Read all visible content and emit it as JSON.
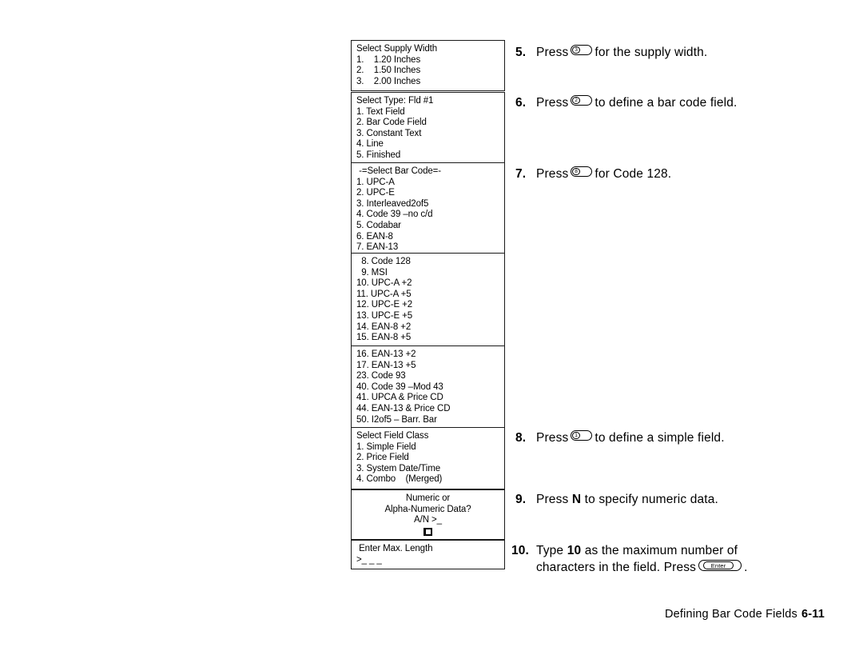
{
  "page": {
    "footer_text": "Defining Bar Code Fields",
    "footer_page": "6-11"
  },
  "screens": [
    {
      "name": "select-supply-width",
      "lines": [
        "Select Supply Width",
        "1.    1.20 Inches",
        "2.    1.50 Inches",
        "3.    2.00 Inches"
      ]
    },
    {
      "name": "select-type-fld1",
      "lines": [
        "Select Type: Fld #1",
        "1. Text Field",
        "2. Bar Code Field",
        "3. Constant Text",
        "4. Line",
        "5. Finished"
      ]
    },
    {
      "name": "select-bar-code-page1",
      "lines": [
        " -=Select Bar Code=-",
        "1. UPC-A",
        "2. UPC-E",
        "3. Interleaved2of5",
        "4. Code 39 –no c/d",
        "5. Codabar",
        "6. EAN-8",
        "7. EAN-13"
      ]
    },
    {
      "name": "select-bar-code-page2",
      "lines": [
        "  8. Code 128",
        "  9. MSI",
        "10. UPC-A +2",
        "11. UPC-A +5",
        "12. UPC-E +2",
        "13. UPC-E +5",
        "14. EAN-8 +2",
        "15. EAN-8 +5"
      ]
    },
    {
      "name": "select-bar-code-page3",
      "lines": [
        "16. EAN-13 +2",
        "17. EAN-13 +5",
        "23. Code 93",
        "40. Code 39 –Mod 43",
        "41. UPCA & Price CD",
        "44. EAN-13 & Price CD",
        "50. I2of5 – Barr. Bar"
      ]
    },
    {
      "name": "select-field-class",
      "lines": [
        "Select Field Class",
        "1. Simple Field",
        "2. Price Field",
        "3. System Date/Time",
        "4. Combo    (Merged)"
      ]
    },
    {
      "name": "numeric-or-alpha-numeric-prompt",
      "lines": [
        "Numeric or",
        "Alpha-Numeric Data?",
        "A/N >_"
      ]
    },
    {
      "name": "enter-max-length",
      "lines": [
        " Enter Max. Length",
        ">_ _ _"
      ]
    }
  ],
  "steps": [
    {
      "number": "5.",
      "pre": "Press",
      "key": "3",
      "post": "for the supply width."
    },
    {
      "number": "6.",
      "pre": "Press",
      "key": "2",
      "post": "to define a bar code field."
    },
    {
      "number": "7.",
      "pre": "Press",
      "key": "8",
      "post": "for Code 128."
    },
    {
      "number": "8.",
      "pre": "Press",
      "key": "1",
      "post": "to define a simple field."
    },
    {
      "number": "9.",
      "pre": "Press",
      "emphasis": "N",
      "post": "to specify numeric data."
    },
    {
      "number": "10.",
      "pre": "Type",
      "emphasis": "10",
      "post": "as the maximum number of characters in the field.  Press",
      "key_label": "Enter",
      "tail": "."
    }
  ]
}
